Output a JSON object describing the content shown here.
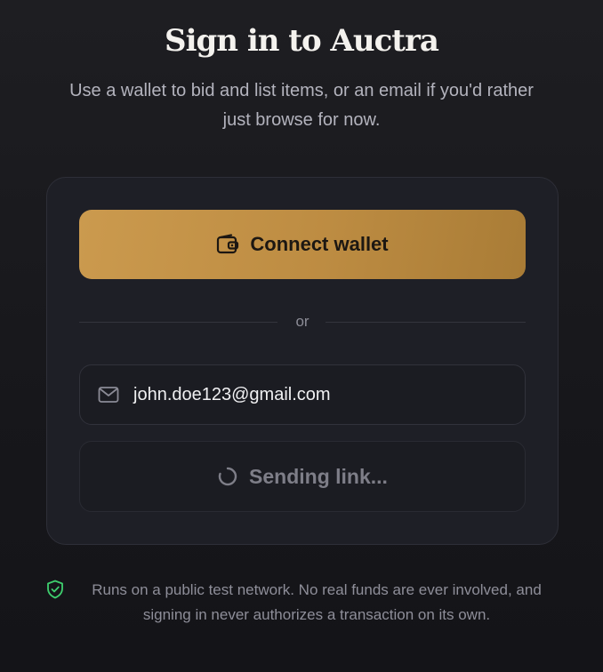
{
  "header": {
    "title": "Sign in to Auctra",
    "subtitle": "Use a wallet to bid and list items, or an email if you'd rather just browse for now."
  },
  "card": {
    "connect_button": {
      "label": "Connect wallet",
      "icon": "wallet-icon"
    },
    "divider_text": "or",
    "email": {
      "value": "john.doe123@gmail.com",
      "icon": "mail-icon"
    },
    "send_button": {
      "label": "Sending link...",
      "icon": "spinner-icon",
      "state": "loading"
    }
  },
  "footer": {
    "icon": "shield-check-icon",
    "text": "Runs on a public test network. No real funds are ever involved, and signing in never authorizes a transaction on its own."
  },
  "colors": {
    "accent": "#c4944a",
    "background": "#19191d",
    "card": "#1e1f26",
    "success": "#3ecf6e"
  }
}
